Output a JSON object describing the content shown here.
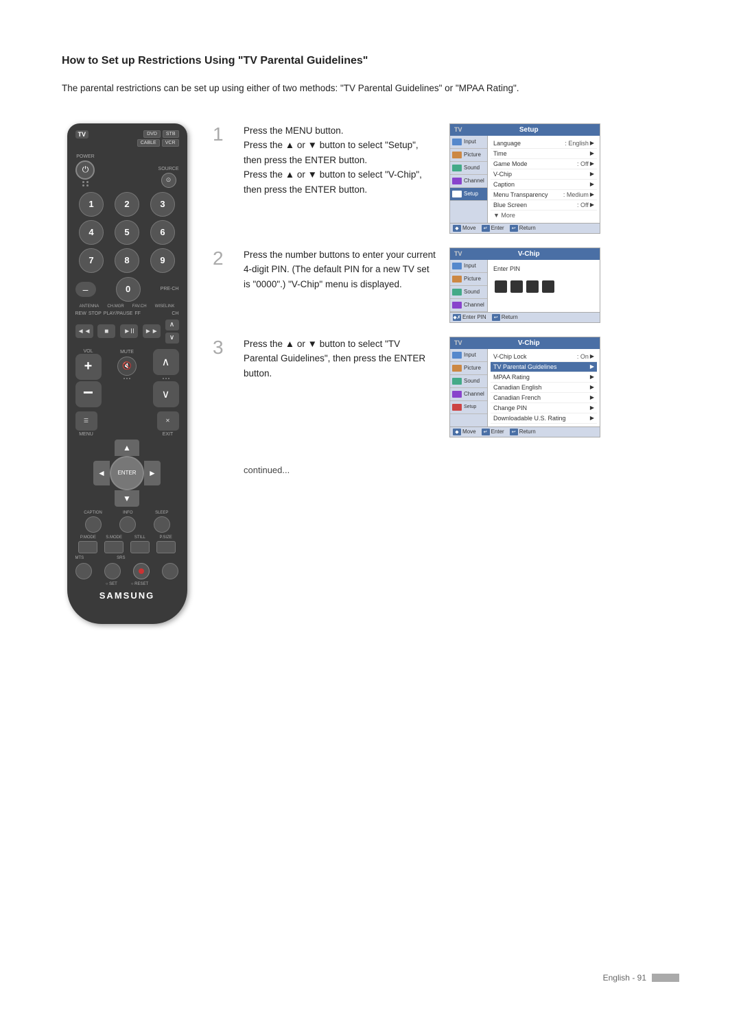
{
  "page": {
    "title": "How to Set up Restrictions Using \"TV Parental Guidelines\"",
    "intro": "The parental restrictions can be set up using either of two methods: \"TV Parental Guidelines\" or \"MPAA Rating\".",
    "continued": "continued...",
    "footer": {
      "text": "English - 91"
    }
  },
  "steps": [
    {
      "number": "1",
      "text_lines": [
        "Press the MENU button.",
        "Press the ▲ or ▼ button to select \"Setup\", then press the ENTER button.",
        "Press the ▲ or ▼ button to select \"V-Chip\", then press the ENTER button."
      ],
      "screen": {
        "tv_label": "TV",
        "title": "Setup",
        "sidebar_items": [
          "Input",
          "Picture",
          "Sound",
          "Channel",
          "Setup"
        ],
        "active_sidebar": "Setup",
        "menu_items": [
          {
            "name": "Language",
            "value": ": English",
            "arrow": true
          },
          {
            "name": "Time",
            "value": "",
            "arrow": true
          },
          {
            "name": "Game Mode",
            "value": ": Off",
            "arrow": true
          },
          {
            "name": "V-Chip",
            "value": "",
            "arrow": true
          },
          {
            "name": "Caption",
            "value": "",
            "arrow": true
          },
          {
            "name": "Menu Transparency",
            "value": ": Medium",
            "arrow": true
          },
          {
            "name": "Blue Screen",
            "value": ": Off",
            "arrow": true
          }
        ],
        "more": "▼ More",
        "bottom": [
          "◆ Move",
          "↵ Enter",
          "↩ Return"
        ]
      }
    },
    {
      "number": "2",
      "text_lines": [
        "Press the number buttons to enter your current 4-digit PIN. (The default PIN for a new TV set is \"0000\".) \"V-Chip\" menu is displayed."
      ],
      "screen": {
        "tv_label": "TV",
        "title": "V-Chip",
        "sidebar_items": [
          "Input",
          "Picture",
          "Sound",
          "Channel"
        ],
        "active_sidebar": "",
        "label": "Enter PIN",
        "pin_dots": 4,
        "bottom": [
          "◆✗ Enter PIN",
          "↩ Return"
        ]
      }
    },
    {
      "number": "3",
      "text_lines": [
        "Press the ▲ or ▼ button to select \"TV Parental Guidelines\", then press the ENTER button."
      ],
      "screen": {
        "tv_label": "TV",
        "title": "V-Chip",
        "sidebar_items": [
          "Input",
          "Picture",
          "Sound",
          "Channel"
        ],
        "active_sidebar": "",
        "menu_items": [
          {
            "name": "V-Chip Lock",
            "value": ": On",
            "arrow": true,
            "highlighted": false
          },
          {
            "name": "TV Parental Guidelines",
            "value": "",
            "arrow": true,
            "highlighted": true
          },
          {
            "name": "MPAA Rating",
            "value": "",
            "arrow": true,
            "highlighted": false
          },
          {
            "name": "Canadian English",
            "value": "",
            "arrow": true,
            "highlighted": false
          },
          {
            "name": "Canadian French",
            "value": "",
            "arrow": true,
            "highlighted": false
          },
          {
            "name": "Change PIN",
            "value": "",
            "arrow": true,
            "highlighted": false
          },
          {
            "name": "Downloadable U.S. Rating",
            "value": "",
            "arrow": true,
            "highlighted": false
          }
        ],
        "bottom": [
          "◆ Move",
          "↵ Enter",
          "↩ Return"
        ]
      }
    }
  ],
  "remote": {
    "brand": "SAMSUNG",
    "buttons": {
      "tv": "TV",
      "dvd": "DVD",
      "stb": "STB",
      "cable": "CABLE",
      "vcr": "VCR",
      "power": "⏻",
      "source": "SOURCE",
      "numbers": [
        "1",
        "2",
        "3",
        "4",
        "5",
        "6",
        "7",
        "8",
        "9",
        "-",
        "0"
      ],
      "pre_ch": "PRE-CH",
      "antenna": "ANTENNA",
      "ch_mgr": "CH.MGR",
      "fav_ch": "FAV.CH",
      "wiselink": "WISELINK",
      "transport": [
        "◄◄",
        "■",
        "►II",
        "►►"
      ],
      "vol_up": "+",
      "ch_up": "∧",
      "mute": "MUTE",
      "vol_down": "",
      "ch_down": "∨",
      "menu": "MENU",
      "exit": "EXIT",
      "enter": "ENTER",
      "caption": "CAPTION",
      "info": "INFO",
      "sleep": "SLEEP",
      "p_mode": "P.MODE",
      "s_mode": "S.MODE",
      "still": "STILL",
      "p_size": "P.SIZE",
      "mts": "MTS",
      "srs": "SRS",
      "set": "SET",
      "reset": "RESET"
    }
  }
}
